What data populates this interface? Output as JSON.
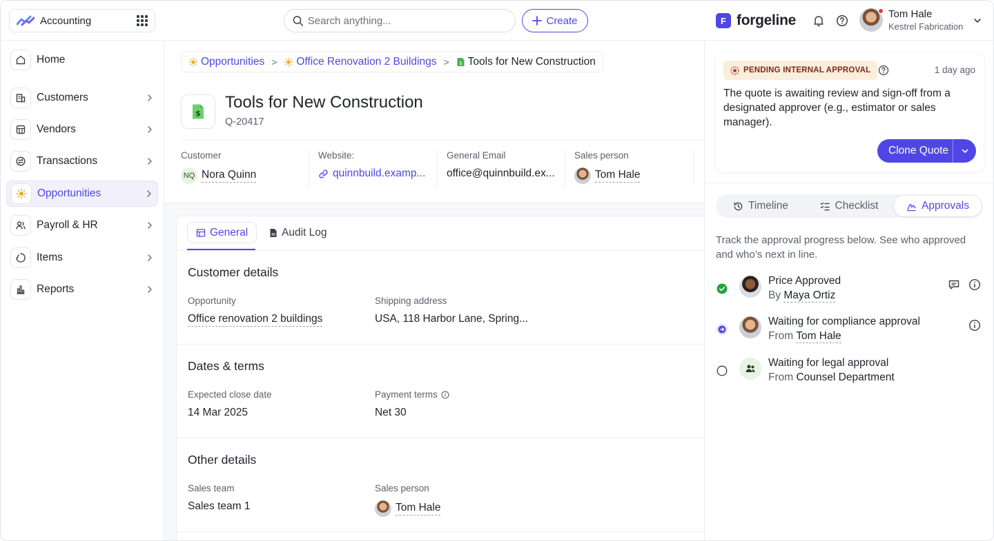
{
  "app": {
    "name": "Accounting"
  },
  "search": {
    "placeholder": "Search anything..."
  },
  "create_label": "Create",
  "brand": {
    "name": "forgeline",
    "mark": "F"
  },
  "user": {
    "name": "Tom Hale",
    "org": "Kestrel Fabrication"
  },
  "sidebar": {
    "items": [
      {
        "label": "Home"
      },
      {
        "label": "Customers"
      },
      {
        "label": "Vendors"
      },
      {
        "label": "Transactions"
      },
      {
        "label": "Opportunities"
      },
      {
        "label": "Payroll & HR"
      },
      {
        "label": "Items"
      },
      {
        "label": "Reports"
      }
    ],
    "active": "Opportunities"
  },
  "breadcrumb": [
    {
      "label": "Opportunities"
    },
    {
      "label": "Office Renovation 2 Buildings"
    },
    {
      "label": "Tools for New Construction"
    }
  ],
  "breadcrumb_sep": ">",
  "quote": {
    "title": "Tools for New Construction",
    "id": "Q-20417"
  },
  "info": {
    "customer_label": "Customer",
    "customer_initials": "NQ",
    "customer": "Nora Quinn",
    "website_label": "Website:",
    "website": "quinnbuild.examp...",
    "email_label": "General Email",
    "email": "office@quinnbuild.ex...",
    "salesperson_label": "Sales person",
    "salesperson": "Tom Hale"
  },
  "tabs": [
    {
      "label": "General"
    },
    {
      "label": "Audit Log"
    }
  ],
  "customer_details": {
    "title": "Customer details",
    "opportunity_label": "Opportunity",
    "opportunity": "Office renovation 2 buildings",
    "shipping_label": "Shipping address",
    "shipping": "USA, 118 Harbor Lane, Spring..."
  },
  "dates_terms": {
    "title": "Dates & terms",
    "close_label": "Expected close date",
    "close": "14 Mar 2025",
    "payment_label": "Payment terms",
    "payment": "Net 30"
  },
  "other_details": {
    "title": "Other details",
    "team_label": "Sales team",
    "team": "Sales team 1",
    "salesperson_label": "Sales person",
    "salesperson": "Tom Hale"
  },
  "status": {
    "badge": "PENDING INTERNAL APPROVAL",
    "time": "1 day ago",
    "description": "The quote is awaiting review and sign-off from a designated approver (e.g., estimator or sales manager).",
    "clone_label": "Clone Quote"
  },
  "panel_tabs": [
    {
      "label": "Timeline"
    },
    {
      "label": "Checklist"
    },
    {
      "label": "Approvals"
    }
  ],
  "approvals": {
    "intro": "Track the approval progress below. See who approved and who’s next in line.",
    "steps": [
      {
        "title": "Price Approved",
        "prefix": "By",
        "who": "Maya Ortiz",
        "state": "done"
      },
      {
        "title": "Waiting for compliance approval",
        "prefix": "From",
        "who": "Tom Hale",
        "state": "current"
      },
      {
        "title": "Waiting for legal approval",
        "prefix": "From",
        "who": "Counsel Department",
        "state": "pending"
      }
    ]
  },
  "colors": {
    "accent": "#4f46e5",
    "done": "#22a53a",
    "badge_bg": "#fbeedc",
    "badge_text": "#7a2d18"
  },
  "icons": [
    "home-icon",
    "customers-icon",
    "vendors-icon",
    "transactions-icon",
    "opportunities-icon",
    "payroll-icon",
    "items-icon",
    "reports-icon",
    "search-icon",
    "plus-icon",
    "bell-icon",
    "help-icon",
    "grid-icon",
    "chevron-right-icon",
    "chevron-down-icon",
    "link-icon",
    "info-icon",
    "comment-icon",
    "history-icon",
    "checklist-icon",
    "approvals-icon",
    "team-icon"
  ]
}
